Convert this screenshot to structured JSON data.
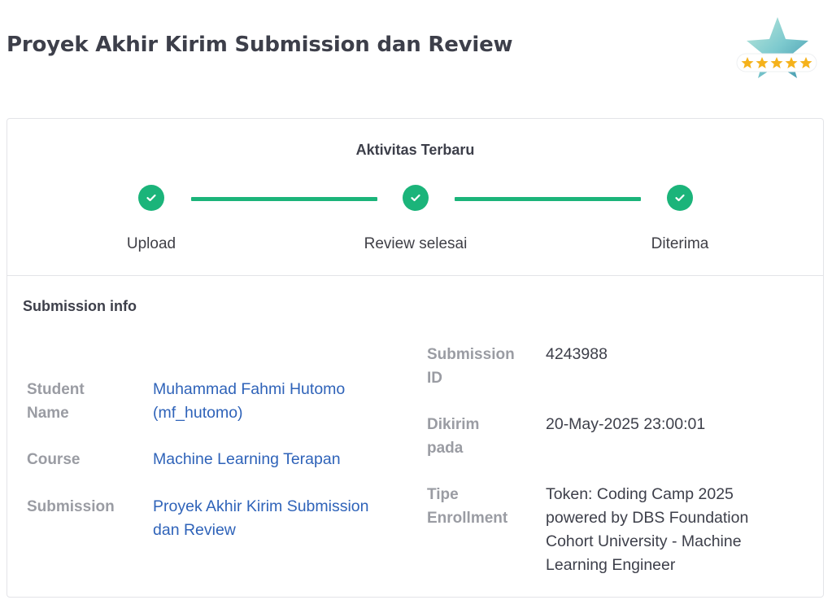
{
  "header": {
    "title": "Proyek Akhir Kirim Submission dan Review"
  },
  "badge": {
    "icon": "star-rating-badge-icon",
    "stars": 5
  },
  "activity": {
    "title": "Aktivitas Terbaru",
    "steps": [
      {
        "label": "Upload",
        "status": "done"
      },
      {
        "label": "Review selesai",
        "status": "done"
      },
      {
        "label": "Diterima",
        "status": "done"
      }
    ],
    "accent_color": "#1bb47a"
  },
  "submission_info": {
    "title": "Submission info",
    "left": {
      "student_name_label": "Student Name",
      "student_name": "Muhammad Fahmi Hutomo (mf_hutomo)",
      "course_label": "Course",
      "course": "Machine Learning Terapan",
      "submission_label": "Submission",
      "submission": "Proyek Akhir Kirim Submission dan Review"
    },
    "right": {
      "submission_id_label": "Submission ID",
      "submission_id": "4243988",
      "sent_label": "Dikirim pada",
      "sent": "20-May-2025 23:00:01",
      "enrollment_label": "Tipe Enrollment",
      "enrollment": "Token: Coding Camp 2025 powered by DBS Foundation Cohort University - Machine Learning Engineer"
    }
  }
}
